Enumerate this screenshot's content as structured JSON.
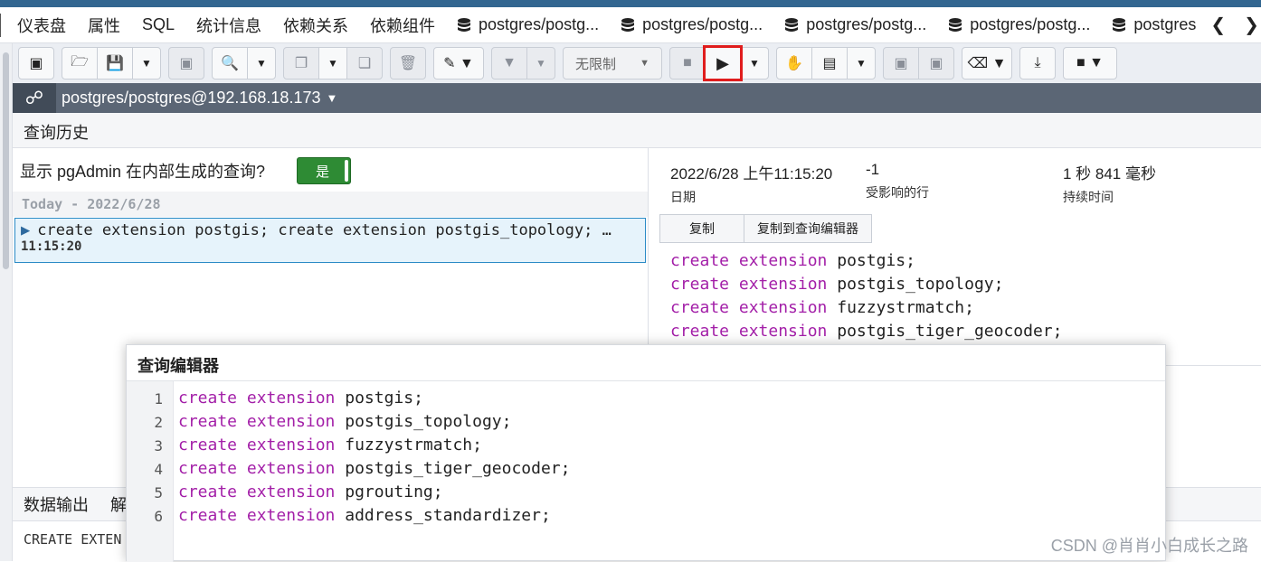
{
  "tabs": [
    {
      "label": "仪表盘"
    },
    {
      "label": "属性"
    },
    {
      "label": "SQL"
    },
    {
      "label": "统计信息"
    },
    {
      "label": "依赖关系"
    },
    {
      "label": "依赖组件"
    },
    {
      "label": "postgres/postg..."
    },
    {
      "label": "postgres/postg..."
    },
    {
      "label": "postgres/postg..."
    },
    {
      "label": "postgres/postg..."
    },
    {
      "label": "postgres"
    }
  ],
  "toolbar": {
    "limit_label": "无限制",
    "icons": [
      "database-icon",
      "open-file-icon",
      "save-icon",
      "chevron-down-icon",
      "save-data-icon",
      "search-icon",
      "copy-icon",
      "paste-icon",
      "delete-icon",
      "edit-icon",
      "filter-icon",
      "stop-icon",
      "execute-icon",
      "explain-icon",
      "explain-analyze-icon",
      "commit-icon",
      "rollback-icon",
      "clear-icon",
      "download-icon",
      "macros-icon"
    ]
  },
  "connection": {
    "label": "postgres/postgres@192.168.18.173"
  },
  "history": {
    "header": "查询历史",
    "show_internal_label": "显示 pgAdmin 在内部生成的查询?",
    "toggle_value": "是",
    "group_label": "Today - 2022/6/28",
    "item_query": "create extension postgis; create extension postgis_topology; …",
    "item_time": "11:15:20"
  },
  "details": {
    "date_value": "2022/6/28 上午11:15:20",
    "date_label": "日期",
    "rows_value": "-1",
    "rows_label": "受影响的行",
    "duration_value": "1 秒 841 毫秒",
    "duration_label": "持续时间",
    "copy_label": "复制",
    "copy_to_editor_label": "复制到查询编辑器",
    "code_lines": [
      {
        "kw": "create extension",
        "rest": "postgis;"
      },
      {
        "kw": "create extension",
        "rest": "postgis_topology;"
      },
      {
        "kw": "create extension",
        "rest": "fuzzystrmatch;"
      },
      {
        "kw": "create extension",
        "rest": "postgis_tiger_geocoder;"
      }
    ]
  },
  "bottom": {
    "tab_data_output": "数据输出",
    "tab_explain": "解",
    "message": "CREATE EXTEN"
  },
  "editor": {
    "title": "查询编辑器",
    "lines": [
      {
        "n": "1",
        "kw": "create extension",
        "rest": "postgis;"
      },
      {
        "n": "2",
        "kw": "create extension",
        "rest": "postgis_topology;"
      },
      {
        "n": "3",
        "kw": "create extension",
        "rest": "fuzzystrmatch;"
      },
      {
        "n": "4",
        "kw": "create extension",
        "rest": "postgis_tiger_geocoder;"
      },
      {
        "n": "5",
        "kw": "create extension",
        "rest": "pgrouting;"
      },
      {
        "n": "6",
        "kw": "create extension",
        "rest": "address_standardizer;"
      }
    ]
  },
  "watermark": "CSDN @肖肖小白成长之路",
  "colors": {
    "keyword": "#a31fa8",
    "highlight": "#e01d1d",
    "toggle": "#2e8b34",
    "header_bar": "#5b6675"
  }
}
